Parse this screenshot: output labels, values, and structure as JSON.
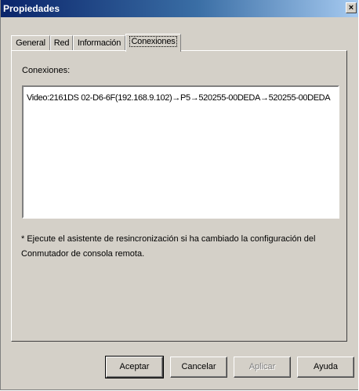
{
  "window": {
    "title": "Propiedades",
    "close_glyph": "×"
  },
  "tabs": [
    {
      "label": "General"
    },
    {
      "label": "Red"
    },
    {
      "label": "Información"
    },
    {
      "label": "Conexiones",
      "active": true
    }
  ],
  "connections": {
    "label": "Conexiones:",
    "items": [
      "Video:2161DS 02-D6-6F(192.168.9.102)→P5→520255-00DEDA→520255-00DEDA"
    ]
  },
  "note": "* Ejecute el asistente de resincronización si ha cambiado la configuración del Conmutador de consola remota.",
  "buttons": {
    "accept": "Aceptar",
    "cancel": "Cancelar",
    "apply": "Aplicar",
    "help": "Ayuda"
  }
}
